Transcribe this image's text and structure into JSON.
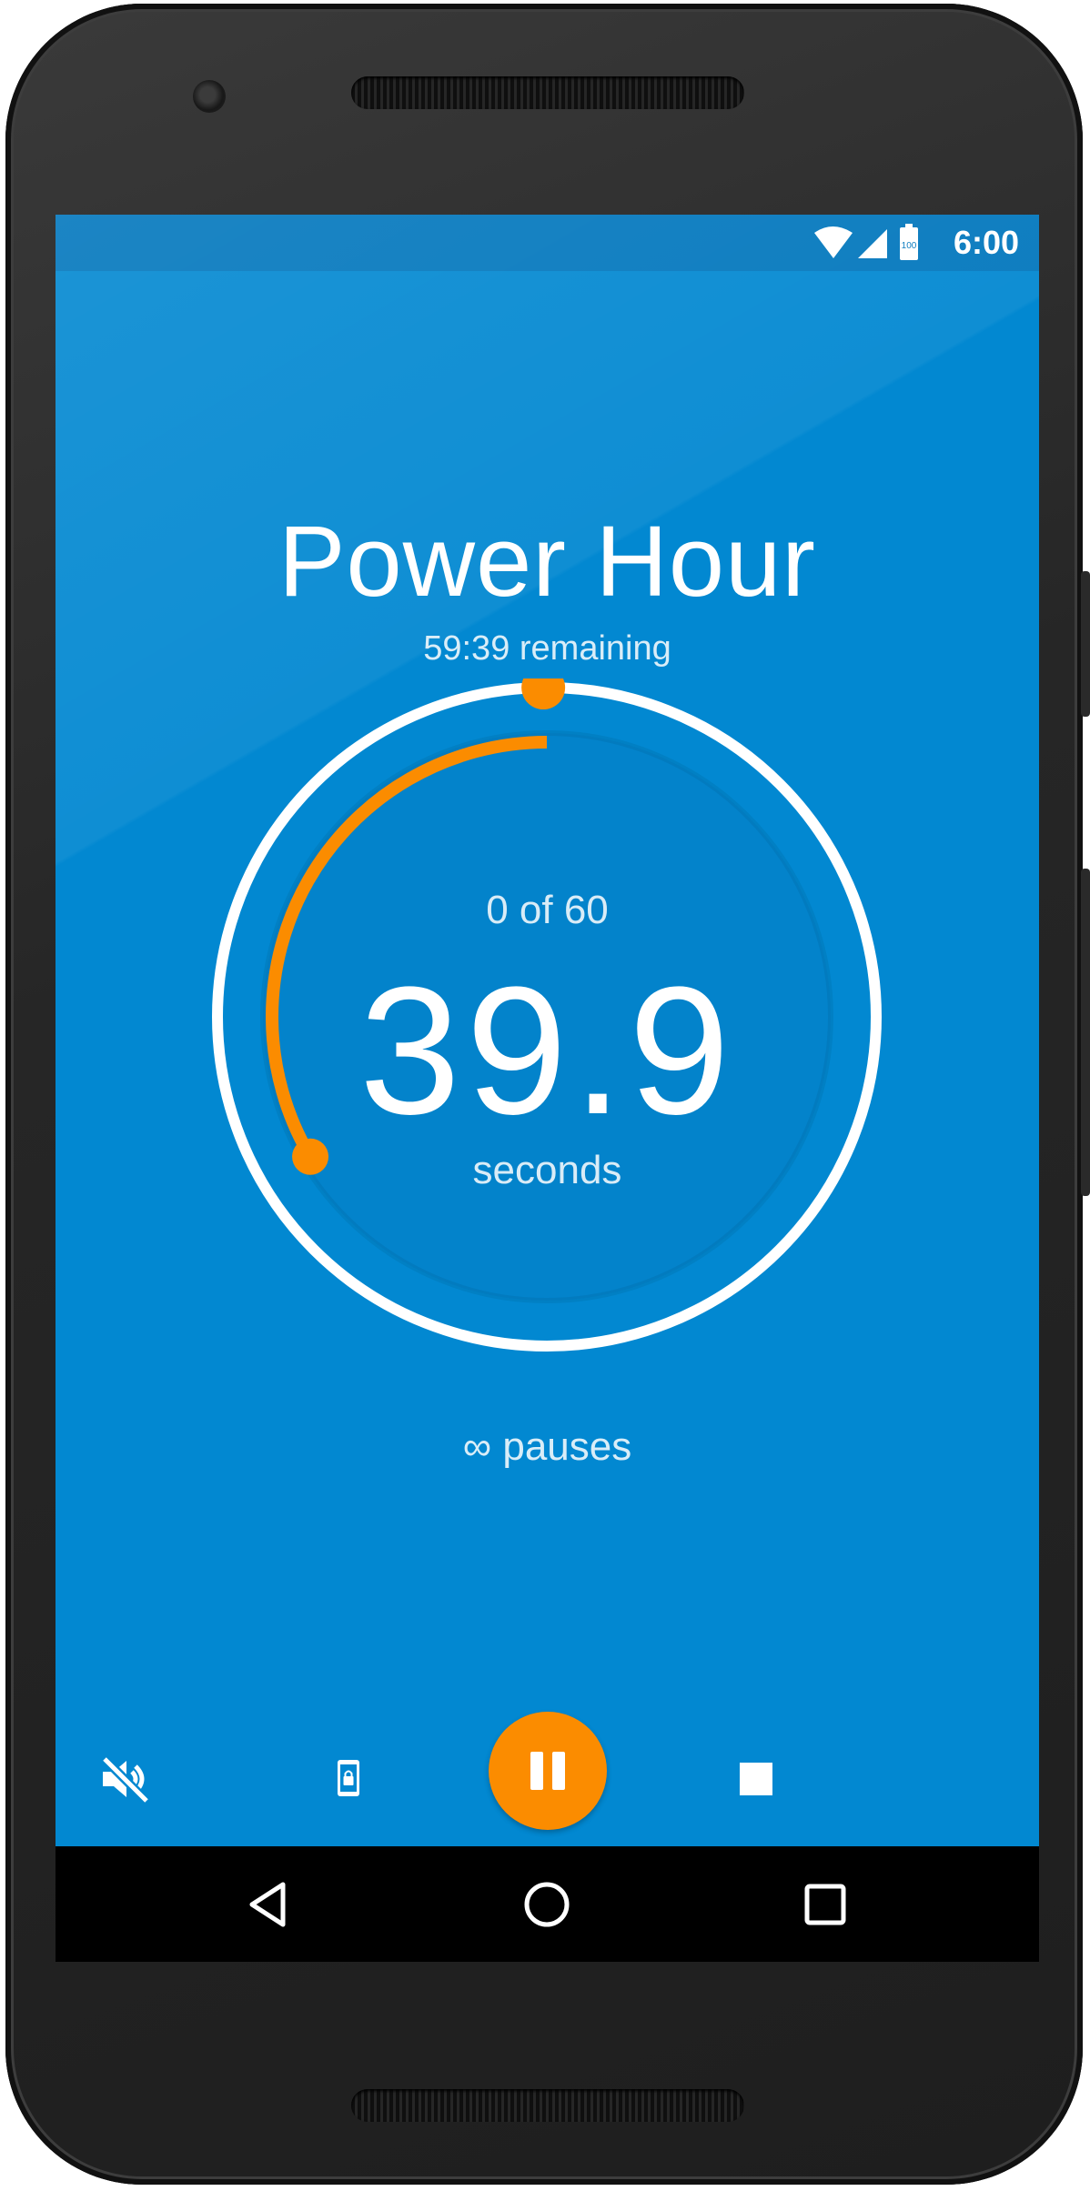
{
  "status_bar": {
    "time": "6:00",
    "battery_level": "100",
    "icons": [
      "wifi-icon",
      "cell-signal-icon",
      "battery-icon"
    ]
  },
  "timer": {
    "title": "Power Hour",
    "remaining": "59:39 remaining",
    "count": "0 of 60",
    "seconds_value": "39.9",
    "seconds_unit": "seconds",
    "pauses": "∞ pauses",
    "minute_progress": 0.0017,
    "seconds_progress": 0.335
  },
  "controls": {
    "icons": [
      "mute-icon",
      "screen-lock-icon",
      "pause-icon",
      "stop-icon"
    ]
  },
  "nav_bar": {
    "icons": [
      "back-icon",
      "home-icon",
      "recents-icon"
    ]
  },
  "colors": {
    "background": "#0288d1",
    "status_bar": "#0277bd",
    "accent": "#fb8c00",
    "ring": "#ffffff"
  }
}
